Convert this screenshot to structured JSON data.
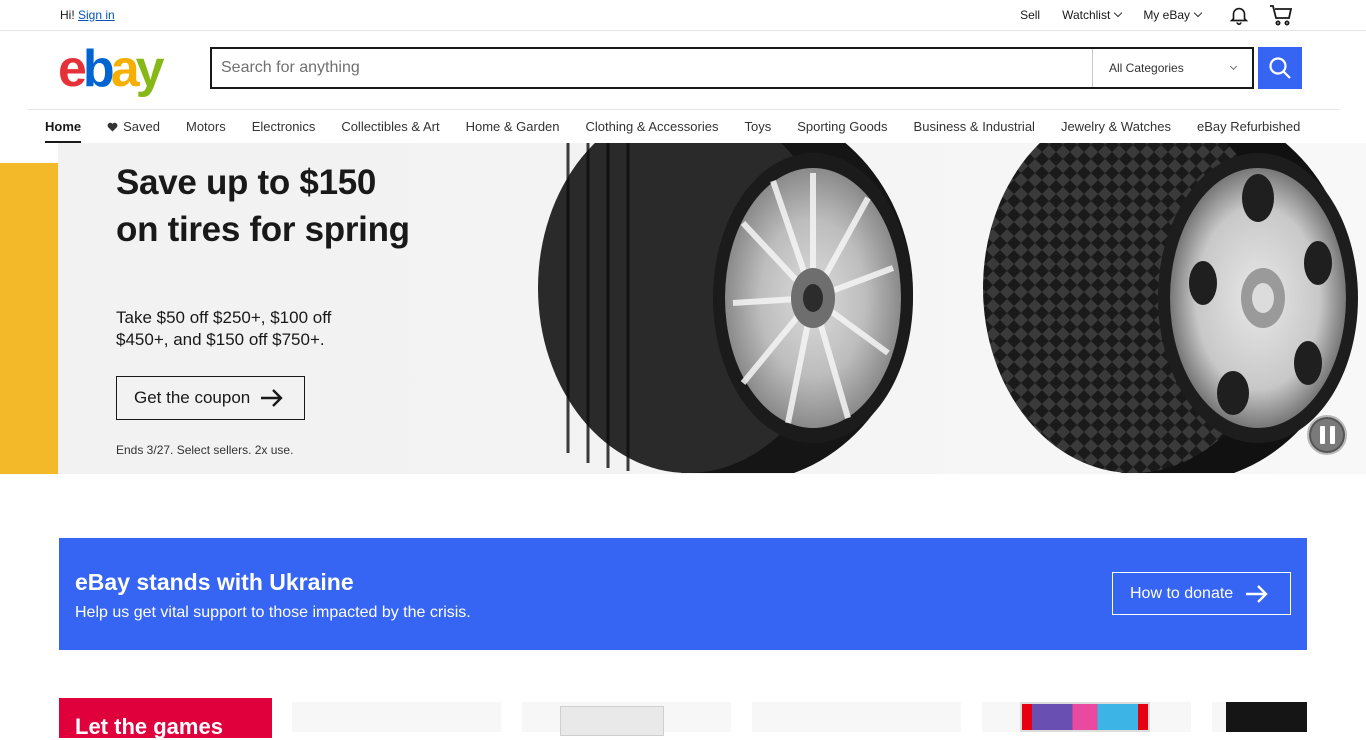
{
  "topbar": {
    "greeting": "Hi!",
    "sign_in": "Sign in",
    "sell": "Sell",
    "watchlist": "Watchlist",
    "my_ebay": "My eBay"
  },
  "header": {
    "logo_letters": [
      "e",
      "b",
      "a",
      "y"
    ],
    "search_placeholder": "Search for anything",
    "category_selected": "All Categories"
  },
  "nav": {
    "items": [
      "Home",
      "Saved",
      "Motors",
      "Electronics",
      "Collectibles & Art",
      "Home & Garden",
      "Clothing & Accessories",
      "Toys",
      "Sporting Goods",
      "Business & Industrial",
      "Jewelry & Watches",
      "eBay Refurbished"
    ]
  },
  "hero": {
    "title": "Save up to $150 on tires for spring",
    "subtitle": "Take $50 off $250+, $100 off $450+, and $150 off $750+.",
    "cta": "Get the coupon",
    "fine_print": "Ends 3/27. Select sellers. 2x use."
  },
  "ukraine": {
    "title": "eBay stands with Ukraine",
    "subtitle": "Help us get vital support to those impacted by the crisis.",
    "button": "How to donate"
  },
  "promo": {
    "title": "Let the games"
  },
  "colors": {
    "accent": "#3665f3",
    "logo_e": "#e53238",
    "logo_b": "#0064d2",
    "logo_a": "#f5af02",
    "logo_y": "#86b817",
    "promo_red": "#e0003c"
  }
}
